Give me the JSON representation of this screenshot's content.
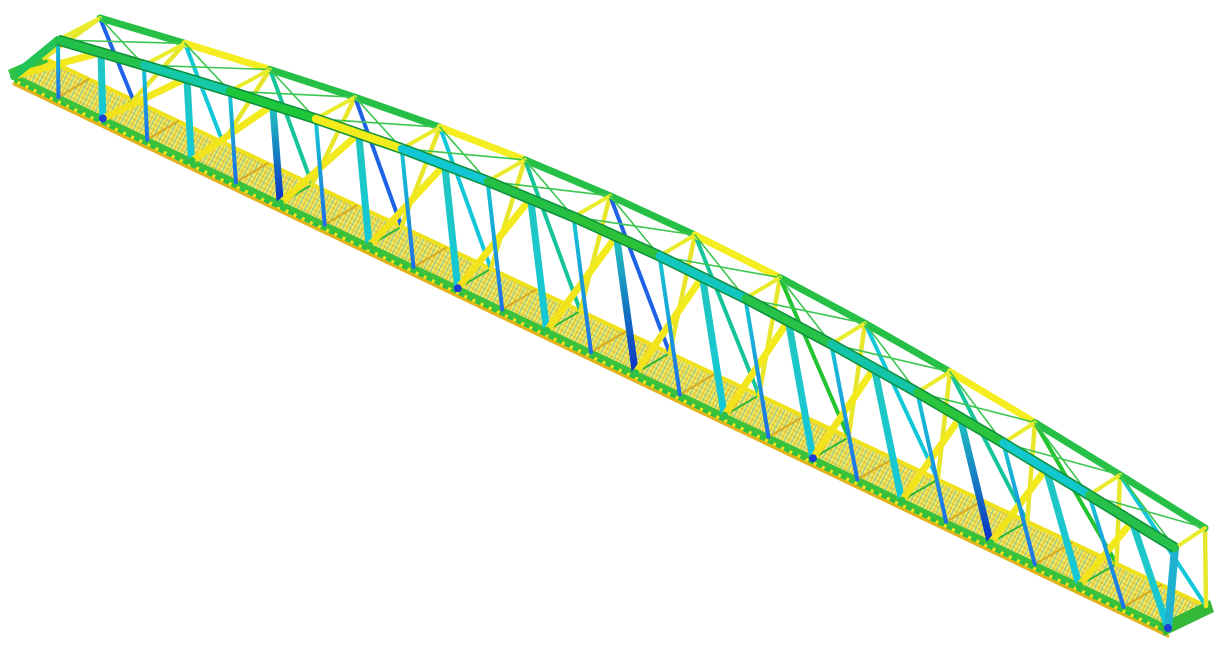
{
  "scene": {
    "subject": "truss-bridge",
    "background_color": "#ffffff",
    "panel_count": 13,
    "colormap": [
      "#0a2fc4",
      "#1e63e6",
      "#12c8d8",
      "#16c49a",
      "#22c230",
      "#8fd416",
      "#f4f20a",
      "#f0c010",
      "#e8a814"
    ]
  }
}
